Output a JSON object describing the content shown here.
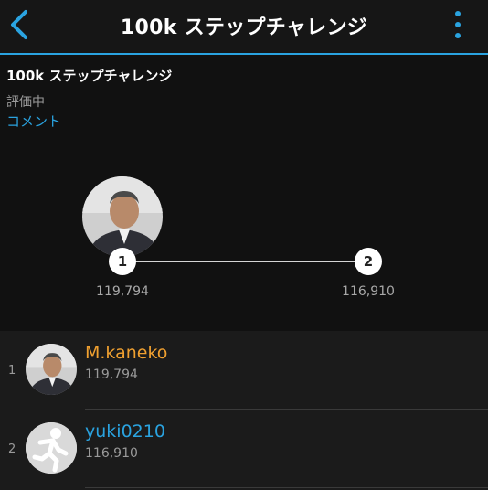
{
  "header": {
    "title": "100k ステップチャレンジ",
    "back_icon": "chevron-left-icon",
    "menu_icon": "more-vertical-icon"
  },
  "info": {
    "challenge_name": "100k ステップチャレンジ",
    "status": "評価中",
    "comment_link": "コメント"
  },
  "track": {
    "positions": [
      {
        "rank": "1",
        "value": "119,794"
      },
      {
        "rank": "2",
        "value": "116,910"
      }
    ]
  },
  "leaderboard": {
    "rows": [
      {
        "rank": "1",
        "name": "M.kaneko",
        "steps": "119,794",
        "name_color": "#f0a030",
        "avatar": "user-photo-avatar"
      },
      {
        "rank": "2",
        "name": "yuki0210",
        "steps": "116,910",
        "name_color": "#2aa3e0",
        "avatar": "default-runner-avatar"
      }
    ]
  },
  "colors": {
    "accent": "#2aa3e0",
    "leader_name": "#f0a030",
    "background": "#111111"
  }
}
